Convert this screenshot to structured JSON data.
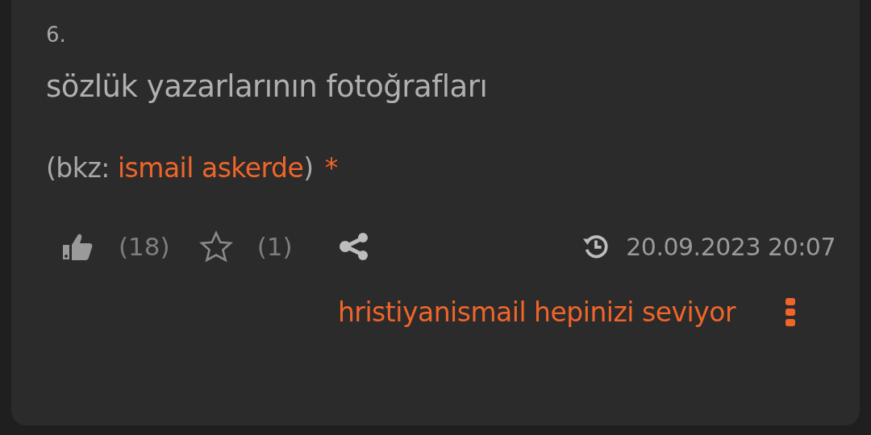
{
  "entry": {
    "number": "6.",
    "text": "sözlük yazarlarının fotoğrafları",
    "reference": {
      "prefix": "(bkz: ",
      "link": "ismail askerde",
      "suffix": ")",
      "mark": "*"
    },
    "likes": "(18)",
    "favorites": "(1)",
    "date": "20.09.2023 20:07",
    "author": "hristiyanismail hepinizi seviyor"
  }
}
